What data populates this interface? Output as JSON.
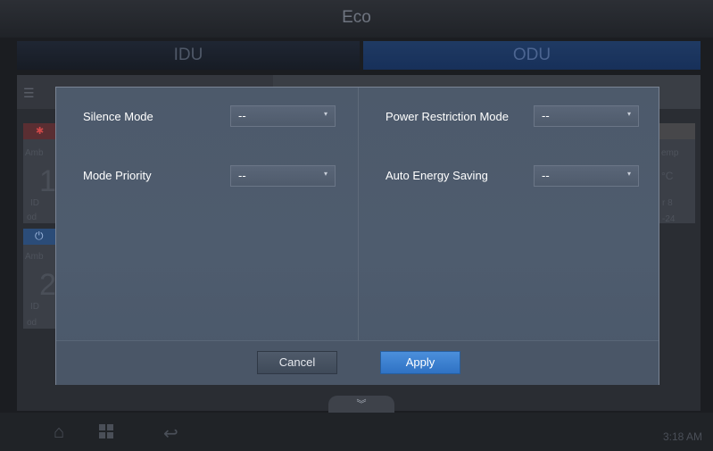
{
  "header": {
    "title": "Eco"
  },
  "tabs": [
    {
      "label": "IDU"
    },
    {
      "label": "ODU"
    }
  ],
  "background": {
    "left_labels": [
      "Amb",
      "ID",
      "od",
      "Amb",
      "ID",
      "od"
    ],
    "big_numbers": [
      "1",
      "2"
    ],
    "right_labels": [
      "emp",
      "°C",
      "r 8",
      "-24"
    ]
  },
  "dialog": {
    "fields": [
      {
        "label": "Silence Mode",
        "value": "--"
      },
      {
        "label": "Power Restriction Mode",
        "value": "--"
      },
      {
        "label": "Mode Priority",
        "value": "--"
      },
      {
        "label": "Auto Energy Saving",
        "value": "--"
      }
    ],
    "cancel_label": "Cancel",
    "apply_label": "Apply"
  },
  "bottombar": {
    "time": "3:18 AM"
  },
  "icons": {
    "home": "home-icon",
    "grid": "grid-icon",
    "back": "back-icon",
    "collapse": "chevron-double-down-icon"
  }
}
